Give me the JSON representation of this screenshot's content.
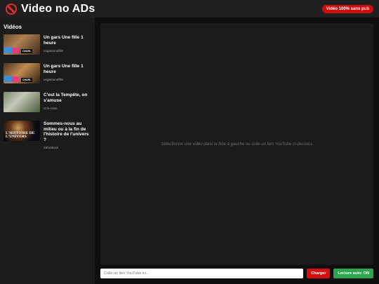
{
  "header": {
    "title": "Video no ADs",
    "logo_icon": "no-entry-icon",
    "badge": "Vidéo 100% sans pub"
  },
  "sidebar": {
    "title": "Vidéos",
    "items": [
      {
        "title": "Un gars Une fille 1 heure",
        "channel": "ungarsunefille",
        "thumb_tag": "CHARL"
      },
      {
        "title": "Un gars Une fille 1 heure",
        "channel": "ungarsunefille",
        "thumb_tag": "CHARL"
      },
      {
        "title": "C'est la Tempête, on s'amuse",
        "channel": "Cris-rosto"
      },
      {
        "title": "Sommes-nous au milieu ou à la fin de l'histoire de l'univers ?",
        "channel": "Zebrakoss",
        "thumb_caption": "L'HISTOIRE DE L'UNIVERS"
      }
    ]
  },
  "player": {
    "placeholder": "Sélectionne une vidéo dans la liste à gauche ou colle un lien YouTube ci-dessous"
  },
  "controls": {
    "input_placeholder": "Colle un lien YouTube ici...",
    "load_label": "Charger",
    "autoplay_label": "Lecture auto: ON"
  },
  "colors": {
    "accent_red": "#d40f0f",
    "accent_green": "#2ea44f",
    "background": "#0f0f0f",
    "panel": "#1a1a1a"
  }
}
